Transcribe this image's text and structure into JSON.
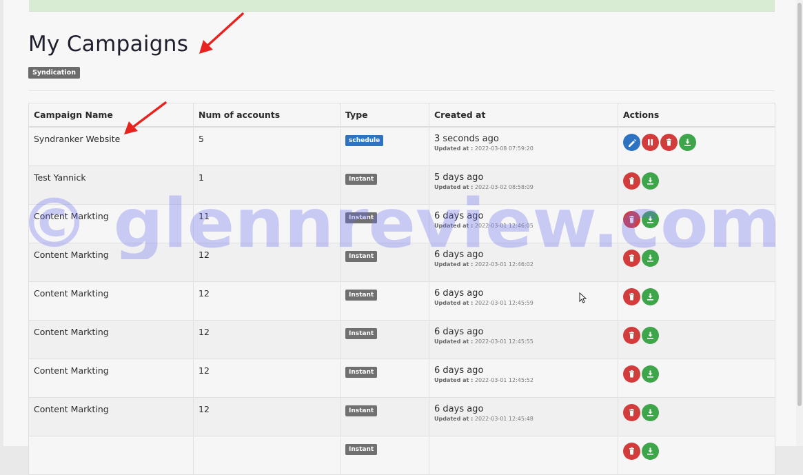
{
  "page": {
    "title": "My Campaigns",
    "tag": "Syndication"
  },
  "table": {
    "columns": [
      "Campaign Name",
      "Num of accounts",
      "Type",
      "Created at",
      "Actions"
    ],
    "updated_prefix": "Updated at :",
    "rows": [
      {
        "name": "Syndranker Website",
        "accounts": "5",
        "type": "schedule",
        "created": "3 seconds ago",
        "updated": "2022-03-08 07:59:20",
        "actions": [
          "edit",
          "pause",
          "delete",
          "download"
        ]
      },
      {
        "name": "Test Yannick",
        "accounts": "1",
        "type": "Instant",
        "created": "5 days ago",
        "updated": "2022-03-02 08:58:09",
        "actions": [
          "delete",
          "download"
        ]
      },
      {
        "name": "Content Markting",
        "accounts": "11",
        "type": "Instant",
        "created": "6 days ago",
        "updated": "2022-03-01 12:46:05",
        "actions": [
          "delete",
          "download"
        ]
      },
      {
        "name": "Content Markting",
        "accounts": "12",
        "type": "Instant",
        "created": "6 days ago",
        "updated": "2022-03-01 12:46:02",
        "actions": [
          "delete",
          "download"
        ]
      },
      {
        "name": "Content Markting",
        "accounts": "12",
        "type": "Instant",
        "created": "6 days ago",
        "updated": "2022-03-01 12:45:59",
        "actions": [
          "delete",
          "download"
        ]
      },
      {
        "name": "Content Markting",
        "accounts": "12",
        "type": "Instant",
        "created": "6 days ago",
        "updated": "2022-03-01 12:45:55",
        "actions": [
          "delete",
          "download"
        ]
      },
      {
        "name": "Content Markting",
        "accounts": "12",
        "type": "Instant",
        "created": "6 days ago",
        "updated": "2022-03-01 12:45:52",
        "actions": [
          "delete",
          "download"
        ]
      },
      {
        "name": "Content Markting",
        "accounts": "12",
        "type": "Instant",
        "created": "6 days ago",
        "updated": "2022-03-01 12:45:48",
        "actions": [
          "delete",
          "download"
        ]
      },
      {
        "name": "",
        "accounts": "",
        "type": "Instant",
        "created": "",
        "updated": "",
        "actions": [
          "delete",
          "download"
        ]
      }
    ]
  },
  "watermark": "© glennreview.com",
  "colors": {
    "schedule_badge": "#2d73c1",
    "instant_badge": "#707070",
    "edit": "#2d73c1",
    "pause": "#d33c3c",
    "delete": "#d33c3c",
    "download": "#3fa54a",
    "annotation_arrow": "#e8231f",
    "watermark": "#6a6cf0"
  },
  "icons": {
    "edit": "pencil-icon",
    "pause": "pause-icon",
    "delete": "trash-icon",
    "download": "download-icon"
  }
}
